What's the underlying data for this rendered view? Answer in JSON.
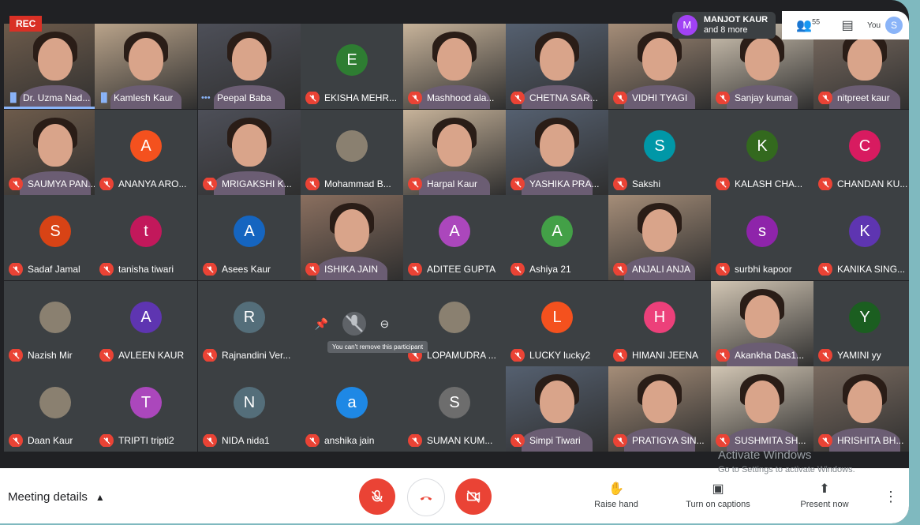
{
  "rec_label": "REC",
  "topbar": {
    "participant_initial": "M",
    "participant_name": "MANJOT KAUR",
    "participant_more": "and 8 more",
    "people_count": "55",
    "you_label": "You",
    "you_initial": "S"
  },
  "tiles": [
    {
      "name": "Dr. Uzma Nad...",
      "type": "video",
      "mic": "speaking",
      "col": 0,
      "row": 0
    },
    {
      "name": "Kamlesh Kaur",
      "type": "video",
      "mic": "speaking",
      "col": 1,
      "row": 0
    },
    {
      "name": "Peepal Baba",
      "type": "video",
      "mic": "dots",
      "col": 2,
      "row": 0
    },
    {
      "name": "EKISHA MEHR...",
      "type": "avatar",
      "initial": "E",
      "color": "#2e7d32",
      "mic": "muted",
      "col": 3,
      "row": 0
    },
    {
      "name": "Mashhood ala...",
      "type": "video",
      "mic": "muted",
      "col": 4,
      "row": 0
    },
    {
      "name": "CHETNA SAR...",
      "type": "video",
      "mic": "muted",
      "col": 5,
      "row": 0
    },
    {
      "name": "VIDHI TYAGI",
      "type": "video",
      "mic": "muted",
      "col": 6,
      "row": 0
    },
    {
      "name": "Sanjay kumar",
      "type": "video",
      "mic": "muted",
      "col": 7,
      "row": 0
    },
    {
      "name": "nitpreet kaur",
      "type": "video",
      "mic": "muted",
      "col": 8,
      "row": 0
    },
    {
      "name": "SAUMYA PAN...",
      "type": "video",
      "mic": "muted",
      "col": 0,
      "row": 1
    },
    {
      "name": "ANANYA ARO...",
      "type": "avatar",
      "initial": "A",
      "color": "#f4511e",
      "mic": "muted",
      "col": 1,
      "row": 1
    },
    {
      "name": "MRIGAKSHI K...",
      "type": "video",
      "mic": "muted",
      "col": 2,
      "row": 1
    },
    {
      "name": "Mohammad B...",
      "type": "avatar-img",
      "mic": "muted",
      "col": 3,
      "row": 1
    },
    {
      "name": "Harpal Kaur",
      "type": "video",
      "mic": "muted",
      "col": 4,
      "row": 1
    },
    {
      "name": "YASHIKA PRA...",
      "type": "video",
      "mic": "muted",
      "col": 5,
      "row": 1
    },
    {
      "name": "Sakshi",
      "type": "avatar",
      "initial": "S",
      "color": "#0097a7",
      "mic": "muted",
      "col": 6,
      "row": 1
    },
    {
      "name": "KALASH CHA...",
      "type": "avatar",
      "initial": "K",
      "color": "#33691e",
      "mic": "muted",
      "col": 7,
      "row": 1
    },
    {
      "name": "CHANDAN KU...",
      "type": "avatar",
      "initial": "C",
      "color": "#d81b60",
      "mic": "muted",
      "col": 8,
      "row": 1
    },
    {
      "name": "Sadaf Jamal",
      "type": "avatar",
      "initial": "S",
      "color": "#d84315",
      "mic": "muted",
      "col": 0,
      "row": 2
    },
    {
      "name": "tanisha tiwari",
      "type": "avatar",
      "initial": "t",
      "color": "#c2185b",
      "mic": "muted",
      "col": 1,
      "row": 2
    },
    {
      "name": "Asees Kaur",
      "type": "avatar",
      "initial": "A",
      "color": "#1565c0",
      "mic": "muted",
      "col": 2,
      "row": 2
    },
    {
      "name": "ISHIKA JAIN",
      "type": "video",
      "mic": "muted",
      "col": 3,
      "row": 2
    },
    {
      "name": "ADITEE GUPTA",
      "type": "avatar",
      "initial": "A",
      "color": "#ab47bc",
      "mic": "muted",
      "col": 4,
      "row": 2
    },
    {
      "name": "Ashiya 21",
      "type": "avatar",
      "initial": "A",
      "color": "#43a047",
      "mic": "muted",
      "col": 5,
      "row": 2
    },
    {
      "name": "ANJALI ANJA",
      "type": "video",
      "mic": "muted",
      "col": 6,
      "row": 2
    },
    {
      "name": "surbhi kapoor",
      "type": "avatar",
      "initial": "s",
      "color": "#8e24aa",
      "mic": "muted",
      "col": 7,
      "row": 2
    },
    {
      "name": "KANIKA SING...",
      "type": "avatar",
      "initial": "K",
      "color": "#5e35b1",
      "mic": "muted",
      "col": 8,
      "row": 2
    },
    {
      "name": "Nazish Mir",
      "type": "avatar-img",
      "mic": "muted",
      "col": 0,
      "row": 3
    },
    {
      "name": "AVLEEN KAUR",
      "type": "avatar",
      "initial": "A",
      "color": "#5e35b1",
      "mic": "muted",
      "col": 1,
      "row": 3
    },
    {
      "name": "Rajnandini Ver...",
      "type": "avatar",
      "initial": "R",
      "color": "#546e7a",
      "mic": "muted",
      "col": 2,
      "row": 3
    },
    {
      "name": "",
      "type": "blank",
      "mic": "muted",
      "col": 3,
      "row": 3
    },
    {
      "name": "LOPAMUDRA ...",
      "type": "avatar-img",
      "mic": "muted",
      "col": 4,
      "row": 3
    },
    {
      "name": "LUCKY lucky2",
      "type": "avatar",
      "initial": "L",
      "color": "#f4511e",
      "mic": "muted",
      "col": 5,
      "row": 3
    },
    {
      "name": "HIMANI JEENA",
      "type": "avatar",
      "initial": "H",
      "color": "#ec407a",
      "mic": "muted",
      "col": 6,
      "row": 3
    },
    {
      "name": "Akankha Das1...",
      "type": "video",
      "mic": "muted",
      "col": 7,
      "row": 3
    },
    {
      "name": "YAMINI yy",
      "type": "avatar",
      "initial": "Y",
      "color": "#1b5e20",
      "mic": "muted",
      "col": 8,
      "row": 3
    },
    {
      "name": "Daan Kaur",
      "type": "avatar-img",
      "mic": "muted",
      "col": 0,
      "row": 4
    },
    {
      "name": "TRIPTI tripti2",
      "type": "avatar",
      "initial": "T",
      "color": "#ab47bc",
      "mic": "muted",
      "col": 1,
      "row": 4
    },
    {
      "name": "NIDA nida1",
      "type": "avatar",
      "initial": "N",
      "color": "#546e7a",
      "mic": "muted",
      "col": 2,
      "row": 4
    },
    {
      "name": "anshika jain",
      "type": "avatar",
      "initial": "a",
      "color": "#1e88e5",
      "mic": "muted",
      "col": 3,
      "row": 4
    },
    {
      "name": "SUMAN KUM...",
      "type": "avatar",
      "initial": "S",
      "color": "#6d6d6d",
      "mic": "muted",
      "col": 4,
      "row": 4
    },
    {
      "name": "Simpi Tiwari",
      "type": "video",
      "mic": "muted",
      "col": 5,
      "row": 4
    },
    {
      "name": "PRATIGYA SIN...",
      "type": "video",
      "mic": "muted",
      "col": 6,
      "row": 4
    },
    {
      "name": "SUSHMITA SH...",
      "type": "video",
      "mic": "muted",
      "col": 7,
      "row": 4
    },
    {
      "name": "HRISHITA BH...",
      "type": "video",
      "mic": "muted",
      "col": 8,
      "row": 4
    }
  ],
  "hover": {
    "tooltip": "You can't remove this participant"
  },
  "watermark": {
    "title": "Activate Windows",
    "subtitle": "Go to Settings to activate Windows."
  },
  "bottombar": {
    "meeting_details": "Meeting details",
    "raise_hand": "Raise hand",
    "captions": "Turn on captions",
    "present": "Present now"
  }
}
